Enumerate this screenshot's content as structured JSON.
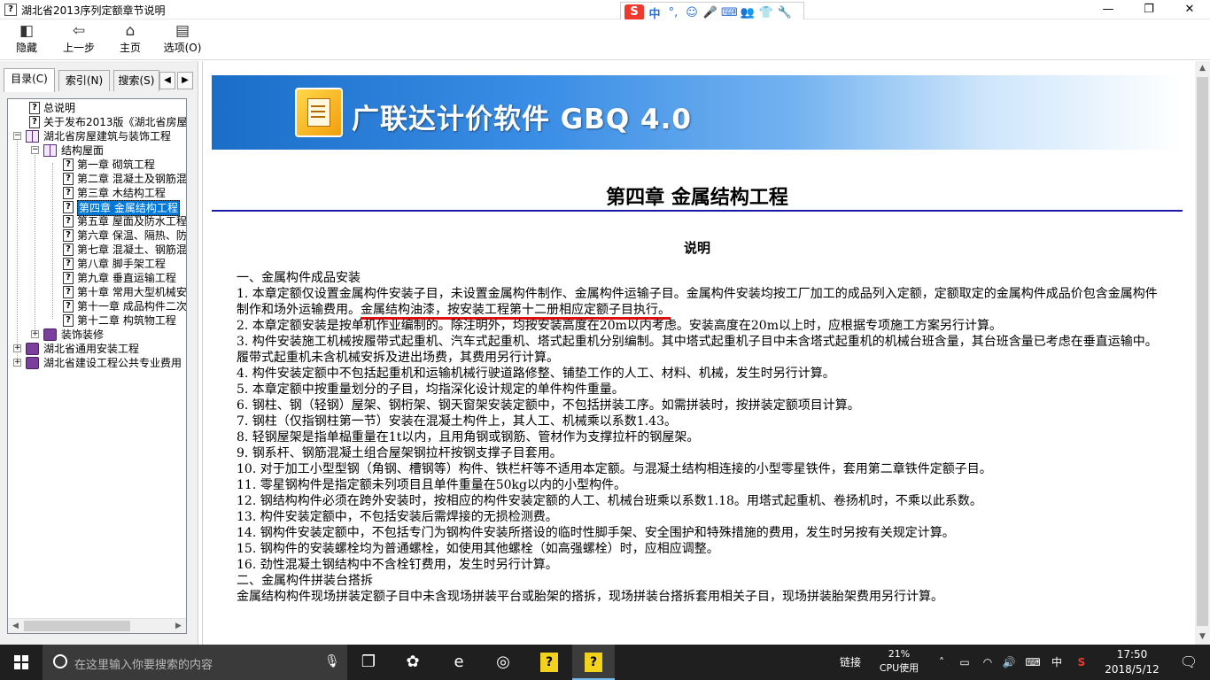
{
  "window": {
    "title": "湖北省2013序列定额章节说明",
    "app_icon": "?",
    "minimize": "—",
    "maximize": "❐",
    "close": "✕"
  },
  "ime": {
    "logo": "S",
    "items": [
      "中",
      "°,",
      "☺",
      "🎤",
      "⌨",
      "👥",
      "👕",
      "🔧"
    ]
  },
  "toolbar": {
    "buttons": [
      {
        "label": "隐藏",
        "icon": "hide-icon",
        "glyph": "◧"
      },
      {
        "label": "上一步",
        "icon": "back-arrow-icon",
        "glyph": "⇦"
      },
      {
        "label": "主页",
        "icon": "home-icon",
        "glyph": "⌂"
      },
      {
        "label": "选项(O)",
        "icon": "options-icon",
        "glyph": "▤"
      }
    ]
  },
  "left_panel": {
    "tabs": [
      "目录(C)",
      "索引(N)",
      "搜索(S)"
    ],
    "tab_prev": "◀",
    "tab_next": "▶",
    "tree": [
      {
        "label": "总说明",
        "icon": "help-page"
      },
      {
        "label": "关于发布2013版《湖北省房屋",
        "icon": "help-page"
      },
      {
        "label": "湖北省房屋建筑与装饰工程",
        "icon": "book-open",
        "expander": "−"
      },
      {
        "label": "结构屋面",
        "icon": "book-open",
        "expander": "−"
      },
      {
        "label": "第一章  砌筑工程",
        "icon": "help-page"
      },
      {
        "label": "第二章  混凝土及钢筋混",
        "icon": "help-page"
      },
      {
        "label": "第三章  木结构工程",
        "icon": "help-page"
      },
      {
        "label": "第四章  金属结构工程",
        "icon": "help-page",
        "selected": true
      },
      {
        "label": "第五章  屋面及防水工程",
        "icon": "help-page"
      },
      {
        "label": "第六章  保温、隔热、防",
        "icon": "help-page"
      },
      {
        "label": "第七章  混凝土、钢筋混",
        "icon": "help-page"
      },
      {
        "label": "第八章  脚手架工程",
        "icon": "help-page"
      },
      {
        "label": "第九章  垂直运输工程",
        "icon": "help-page"
      },
      {
        "label": "第十章  常用大型机械安",
        "icon": "help-page"
      },
      {
        "label": "第十一章  成品构件二次",
        "icon": "help-page"
      },
      {
        "label": "第十二章  构筑物工程",
        "icon": "help-page"
      },
      {
        "label": "装饰装修",
        "icon": "book-closed",
        "expander": "+"
      },
      {
        "label": "湖北省通用安装工程",
        "icon": "book-closed",
        "expander": "+"
      },
      {
        "label": "湖北省建设工程公共专业费用",
        "icon": "book-closed",
        "expander": "+"
      }
    ]
  },
  "content": {
    "banner_brand": "广联达计价软件 GBQ 4.0",
    "chapter_title": "第四章  金属结构工程",
    "section_head": "说明",
    "paragraphs": [
      "一、金属构件成品安装",
      "1. 本章定额仅设置金属构件安装子目，未设置金属构件制作、金属构件运输子目。金属构件安装均按工厂加工的成品列入定额，定额取定的金属构件成品价包含金属构件制作和场外运输费用。",
      "2. 本章定额安装是按单机作业编制的。除注明外，均按安装高度在20m以内考虑。安装高度在20m以上时，应根据专项施工方案另行计算。",
      "3. 构件安装施工机械按履带式起重机、汽车式起重机、塔式起重机分别编制。其中塔式起重机子目中未含塔式起重机的机械台班含量，其台班含量已考虑在垂直运输中。履带式起重机未含机械安拆及进出场费，其费用另行计算。",
      "4. 构件安装定额中不包括起重机和运输机械行驶道路修整、铺垫工作的人工、材料、机械，发生时另行计算。",
      "5. 本章定额中按重量划分的子目，均指深化设计规定的单件构件重量。",
      "6. 钢柱、钢（轻钢）屋架、钢桁架、钢天窗架安装定额中，不包括拼装工序。如需拼装时，按拼装定额项目计算。",
      "7. 钢柱（仅指钢柱第一节）安装在混凝土构件上，其人工、机械乘以系数1.43。",
      "8. 轻钢屋架是指单榀重量在1t以内，且用角钢或钢筋、管材作为支撑拉杆的钢屋架。",
      "9. 钢系杆、钢筋混凝土组合屋架钢拉杆按钢支撑子目套用。",
      "10. 对于加工小型型钢（角钢、槽钢等）构件、铁栏杆等不适用本定额。与混凝土结构相连接的小型零星铁件，套用第二章铁件定额子目。",
      "11. 零星钢构件是指定额未列项目且单件重量在50kg以内的小型构件。",
      "12. 钢结构构件必须在跨外安装时，按相应的构件安装定额的人工、机械台班乘以系数1.18。用塔式起重机、卷扬机时，不乘以此系数。",
      "13. 构件安装定额中，不包括安装后需焊接的无损检测费。",
      "14. 钢构件安装定额中，不包括专门为钢构件安装所搭设的临时性脚手架、安全围护和特殊措施的费用，发生时另按有关规定计算。",
      "15. 钢构件的安装螺栓均为普通螺栓，如使用其他螺栓（如高强螺栓）时，应相应调整。",
      "16. 劲性混凝土钢结构中不含栓钉费用，发生时另行计算。",
      "二、金属构件拼装台搭拆",
      "金属结构构件现场拼装定额子目中未含现场拼装平台或胎架的搭拆，现场拼装台搭拆套用相关子目，现场拼装胎架费用另行计算。"
    ],
    "underlined_sentence": "金属结构油漆，按安装工程第十二册相应定额子目执行。",
    "underline_color": "#e01010"
  },
  "taskbar": {
    "search_placeholder": "在这里输入你要搜索的内容",
    "mic": "🎙",
    "apps": [
      {
        "name": "task-view",
        "glyph": "❐"
      },
      {
        "name": "app-flower",
        "glyph": "✿"
      },
      {
        "name": "edge",
        "glyph": "e"
      },
      {
        "name": "app-swirl",
        "glyph": "◎"
      },
      {
        "name": "help-app-1",
        "glyph": "?"
      },
      {
        "name": "help-app-2",
        "glyph": "?"
      }
    ],
    "link_label": "链接",
    "cpu_percent": "21%",
    "cpu_label": "CPU使用",
    "tray": [
      "˄",
      "▭",
      "◠",
      "🔊",
      "⌨",
      "中",
      "S"
    ],
    "time": "17:50",
    "date": "2018/5/12",
    "notify": "🗨"
  }
}
